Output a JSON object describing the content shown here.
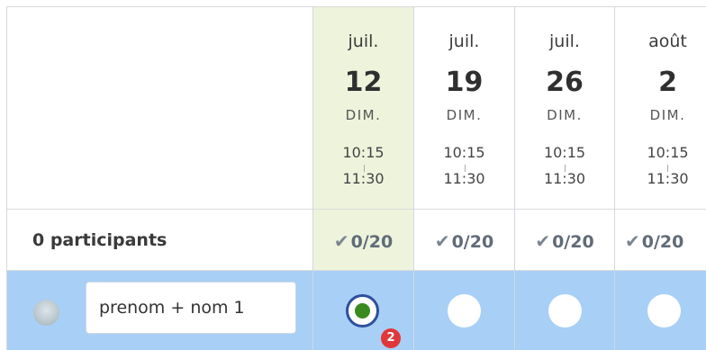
{
  "summary": {
    "participants_label": "0 participants"
  },
  "dates": [
    {
      "month": "juil.",
      "day": "12",
      "weekday": "DIM.",
      "start": "10:15",
      "end": "11:30",
      "count": "0/20",
      "selected": true
    },
    {
      "month": "juil.",
      "day": "19",
      "weekday": "DIM.",
      "start": "10:15",
      "end": "11:30",
      "count": "0/20",
      "selected": false
    },
    {
      "month": "juil.",
      "day": "26",
      "weekday": "DIM.",
      "start": "10:15",
      "end": "11:30",
      "count": "0/20",
      "selected": false
    },
    {
      "month": "août",
      "day": "2",
      "weekday": "DIM.",
      "start": "10:15",
      "end": "11:30",
      "count": "0/20",
      "selected": false
    }
  ],
  "user_row": {
    "name_value": "prenom + nom 1",
    "answers": [
      "yes",
      "none",
      "none",
      "none"
    ],
    "badge_count": "2"
  },
  "icons": {
    "check": "check-icon",
    "avatar": "avatar-image"
  },
  "colors": {
    "selected_column": "#eef3dc",
    "user_row": "#a8cff5",
    "yes_dot": "#3a8a1f",
    "badge": "#e0373a"
  }
}
